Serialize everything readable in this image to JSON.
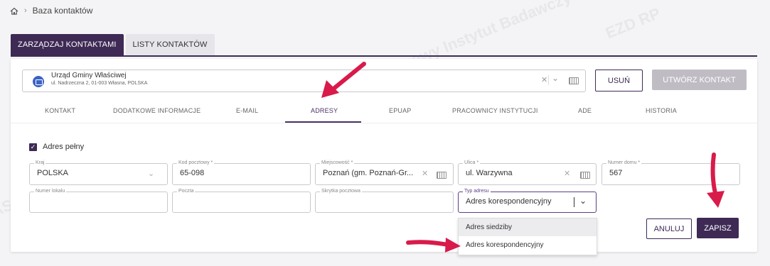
{
  "breadcrumb": {
    "home_icon": "home-icon",
    "current": "Baza kontaktów"
  },
  "top_tabs": [
    {
      "label": "ZARZĄDZAJ KONTAKTAMI",
      "active": true
    },
    {
      "label": "LISTY KONTAKTÓW",
      "active": false
    }
  ],
  "contact_selector": {
    "name": "Urząd Gminy Właściwej",
    "address": "ul. Nadrzeczna 2, 01-003 Własna, POLSKA"
  },
  "buttons": {
    "delete_label": "USUŃ",
    "create_label": "UTWÓRZ KONTAKT",
    "cancel_label": "ANULUJ",
    "save_label": "ZAPISZ"
  },
  "sub_tabs": [
    {
      "label": "KONTAKT"
    },
    {
      "label": "DODATKOWE INFORMACJE"
    },
    {
      "label": "E-MAIL"
    },
    {
      "label": "ADRESY",
      "active": true
    },
    {
      "label": "EPUAP"
    },
    {
      "label": "PRACOWNICY INSTYTUCJI"
    },
    {
      "label": "ADE"
    },
    {
      "label": "HISTORIA"
    }
  ],
  "full_address": {
    "label": "Adres pełny",
    "checked": true
  },
  "fields": {
    "country": {
      "label": "Kraj",
      "value": "POLSKA"
    },
    "postal_code": {
      "label": "Kod pocztowy *",
      "value": "65-098"
    },
    "city": {
      "label": "Miejscowość *",
      "value": "Poznań (gm. Poznań-Gr..."
    },
    "street": {
      "label": "Ulica *",
      "value": "ul. Warzywna"
    },
    "house_number": {
      "label": "Numer domu *",
      "value": "567"
    },
    "apartment": {
      "label": "Numer lokalu",
      "value": ""
    },
    "post_office": {
      "label": "Poczta",
      "value": ""
    },
    "po_box": {
      "label": "Skrytka pocztowa",
      "value": ""
    },
    "address_type": {
      "label": "Typ adresu",
      "value": "Adres korespondencyjny"
    }
  },
  "address_type_options": [
    "Adres siedziby",
    "Adres korespondencyjny"
  ],
  "watermarks": [
    "NASK Państwowy Instytut Badawczy",
    "EZD RP"
  ],
  "colors": {
    "accent": "#3e2a55",
    "annotation_arrow": "#d81b4a",
    "disabled_button": "#c0bcc4"
  }
}
